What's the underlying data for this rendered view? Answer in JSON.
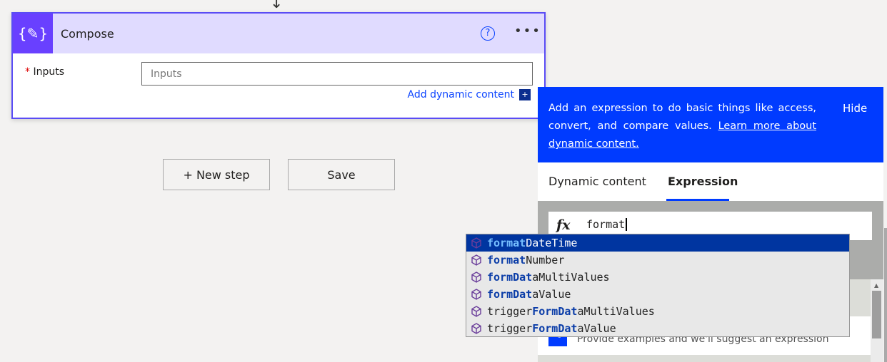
{
  "card": {
    "title": "Compose",
    "icon": "curly-braces-pencil-icon",
    "inputs_label": "Inputs",
    "required_mark": "*",
    "inputs_placeholder": "Inputs",
    "add_dynamic": "Add dynamic content",
    "add_dynamic_icon": "+"
  },
  "canvas": {
    "new_step": "+ New step",
    "save": "Save"
  },
  "panel": {
    "desc": "Add an expression to do basic things like access, convert, and compare values.",
    "learn_more": "Learn more about dynamic content.",
    "hide": "Hide",
    "tabs": [
      "Dynamic content",
      "Expression"
    ],
    "active_tab": "Expression",
    "fx": "fx",
    "expression_value": "format",
    "suggest_text": "Provide examples and we'll suggest an expression"
  },
  "colors": {
    "accent": "#003bff",
    "card_icon": "#6940ff",
    "card_header": "#e0dbff",
    "selected": "#0035a0"
  },
  "autocomplete": [
    {
      "parts": [
        [
          "format",
          1
        ],
        [
          "DateTime",
          0
        ]
      ],
      "selected": true
    },
    {
      "parts": [
        [
          "format",
          1
        ],
        [
          "Number",
          0
        ]
      ]
    },
    {
      "parts": [
        [
          "form",
          1
        ],
        [
          "Dat",
          1
        ],
        [
          "aMultiValues",
          0
        ]
      ]
    },
    {
      "parts": [
        [
          "form",
          1
        ],
        [
          "Dat",
          1
        ],
        [
          "aValue",
          0
        ]
      ]
    },
    {
      "parts": [
        [
          "trigger",
          0
        ],
        [
          "Form",
          1
        ],
        [
          "Dat",
          1
        ],
        [
          "aMultiValues",
          0
        ]
      ]
    },
    {
      "parts": [
        [
          "trigger",
          0
        ],
        [
          "Form",
          1
        ],
        [
          "Dat",
          1
        ],
        [
          "aValue",
          0
        ]
      ]
    }
  ]
}
